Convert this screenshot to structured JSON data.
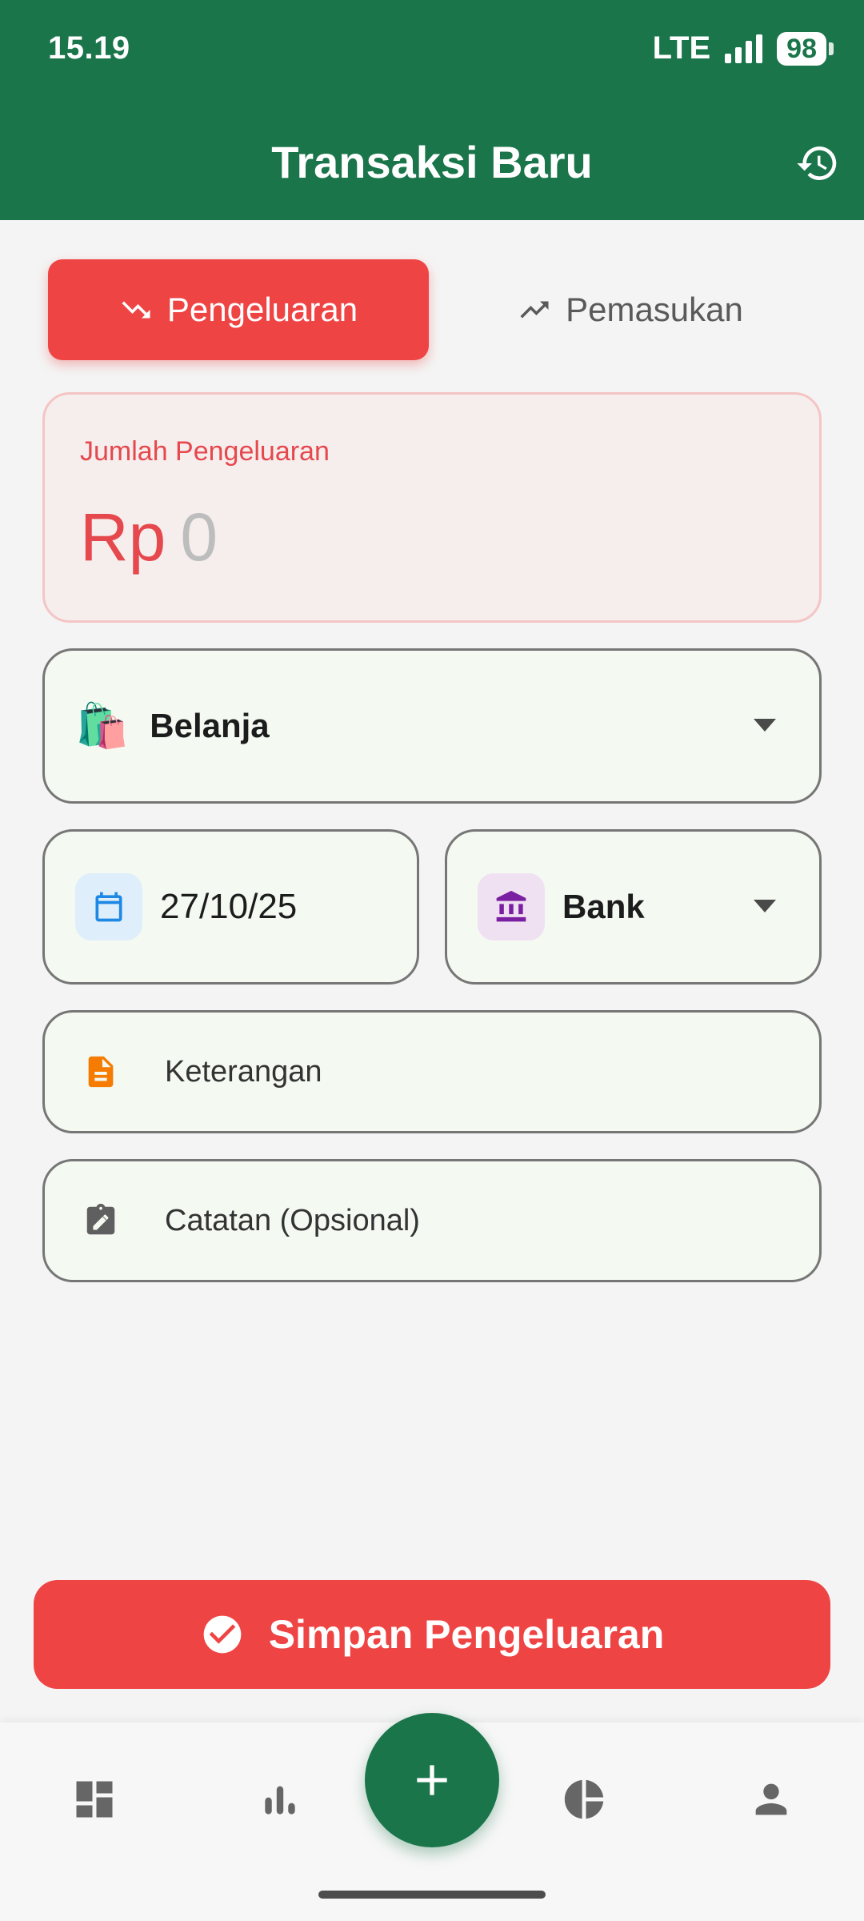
{
  "status_bar": {
    "time": "15.19",
    "network": "LTE",
    "battery": "98"
  },
  "header": {
    "title": "Transaksi Baru",
    "history_icon": "history-icon"
  },
  "type_toggle": {
    "expense_label": "Pengeluaran",
    "income_label": "Pemasukan",
    "selected": "Pengeluaran"
  },
  "amount": {
    "label": "Jumlah Pengeluaran",
    "currency": "Rp",
    "value": "0"
  },
  "category": {
    "emoji": "🛍️",
    "label": "Belanja"
  },
  "date": {
    "value": "27/10/25"
  },
  "account": {
    "label": "Bank"
  },
  "description": {
    "placeholder": "Keterangan"
  },
  "note": {
    "placeholder": "Catatan (Opsional)"
  },
  "save_button": {
    "label": "Simpan Pengeluaran"
  },
  "colors": {
    "primary_green": "#1a754a",
    "expense_red": "#ef4444",
    "date_icon_blue": "#1e88e5",
    "bank_icon_purple": "#7b1fa2",
    "doc_icon_orange": "#f57c00"
  },
  "bottom_nav": {
    "items": [
      "dashboard-icon",
      "bar-chart-icon",
      "add-icon",
      "pie-chart-icon",
      "person-icon"
    ]
  }
}
